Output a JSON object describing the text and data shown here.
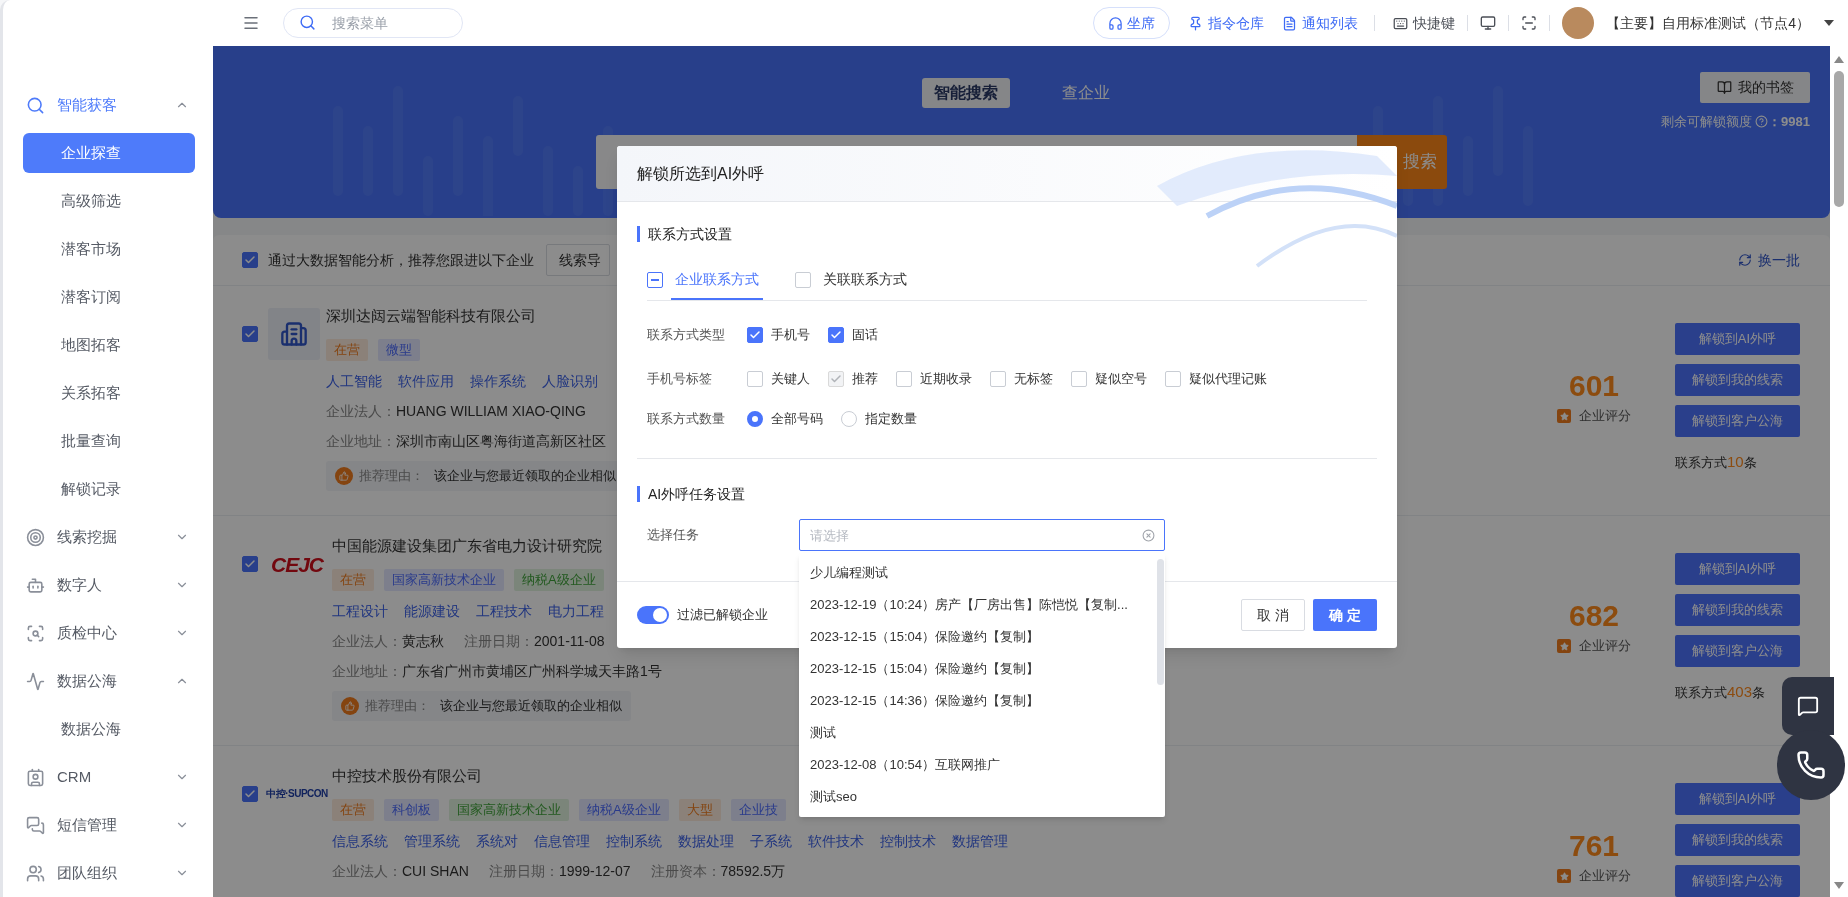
{
  "sidebar": {
    "groups": [
      {
        "label": "智能获客",
        "kind": "search",
        "active": true,
        "expanded": true,
        "children": [
          {
            "label": "企业探查",
            "selected": true
          },
          {
            "label": "高级筛选",
            "selected": false
          },
          {
            "label": "潜客市场",
            "selected": false
          },
          {
            "label": "潜客订阅",
            "selected": false
          },
          {
            "label": "地图拓客",
            "selected": false
          },
          {
            "label": "关系拓客",
            "selected": false
          },
          {
            "label": "批量查询",
            "selected": false
          },
          {
            "label": "解锁记录",
            "selected": false
          }
        ]
      },
      {
        "label": "线索挖掘",
        "kind": "target",
        "active": false,
        "expanded": false
      },
      {
        "label": "数字人",
        "kind": "bot",
        "active": false,
        "expanded": false
      },
      {
        "label": "质检中心",
        "kind": "inspect",
        "active": false,
        "expanded": false
      },
      {
        "label": "数据公海",
        "kind": "data",
        "active": false,
        "expanded": true,
        "children": [
          {
            "label": "数据公海",
            "selected": false
          }
        ]
      },
      {
        "label": "CRM",
        "kind": "crm",
        "active": false,
        "expanded": false
      },
      {
        "label": "短信管理",
        "kind": "sms",
        "active": false,
        "expanded": false
      },
      {
        "label": "团队组织",
        "kind": "team",
        "active": false,
        "expanded": false
      }
    ]
  },
  "header": {
    "menu_search": {
      "placeholder": "搜索菜单"
    },
    "seat_button": "坐席",
    "links": [
      {
        "kind": "commands",
        "label": "指令仓库"
      },
      {
        "kind": "notices",
        "label": "通知列表"
      },
      {
        "kind": "shortcuts",
        "label": "快捷键"
      }
    ],
    "account": "【主要】自用标准测试（节点4）"
  },
  "banner": {
    "tabs": [
      {
        "label": "智能搜索",
        "selected": true
      },
      {
        "label": "查企业",
        "selected": false
      }
    ],
    "search_button": "搜索",
    "bookmark_button": "我的书签",
    "quota_label": "剩余可解锁额度",
    "quota_value": "：9981"
  },
  "list": {
    "select_all": {
      "label": "通过大数据智能分析，推荐您跟进以下企业",
      "checked": true
    },
    "export_button": "线索导",
    "refresh_button": "换一批",
    "companies": [
      {
        "checked": true,
        "logo": {
          "kind": "building"
        },
        "name": "深圳达闼云端智能科技有限公司",
        "tags": [
          {
            "label": "在营",
            "kind": "status"
          },
          {
            "label": "微型",
            "kind": "info"
          }
        ],
        "industries": [
          "人工智能",
          "软件应用",
          "操作系统",
          "人脸识别"
        ],
        "fields": [
          {
            "label": "企业法人：",
            "value": "HUANG WILLIAM XIAO-QING"
          }
        ],
        "address": {
          "label": "企业地址：",
          "value": "深圳市南山区粤海街道高新区社区"
        },
        "reason": {
          "label": "推荐理由：",
          "text": "该企业与您最近领取的企业相似"
        },
        "score": "601",
        "score_label": "企业评分",
        "actions": [
          "解锁到AI外呼",
          "解锁到我的线索",
          "解锁到客户公海"
        ],
        "contacts": {
          "prefix": "联系方式",
          "count": "10",
          "suffix": "条"
        }
      },
      {
        "checked": true,
        "logo": {
          "kind": "wordmark",
          "text": "CEJC"
        },
        "name": "中国能源建设集团广东省电力设计研究院",
        "tags": [
          {
            "label": "在营",
            "kind": "status"
          },
          {
            "label": "国家高新技术企业",
            "kind": "info"
          },
          {
            "label": "纳税A级企业",
            "kind": "success"
          }
        ],
        "industries": [
          "工程设计",
          "能源建设",
          "工程技术",
          "电力工程"
        ],
        "fields": [
          {
            "label": "企业法人：",
            "value": "黄志秋"
          },
          {
            "label": "注册日期：",
            "value": "2001-11-08"
          }
        ],
        "address": {
          "label": "企业地址：",
          "value": "广东省广州市黄埔区广州科学城天丰路1号"
        },
        "reason": {
          "label": "推荐理由：",
          "text": "该企业与您最近领取的企业相似"
        },
        "score": "682",
        "score_label": "企业评分",
        "actions": [
          "解锁到AI外呼",
          "解锁到我的线索",
          "解锁到客户公海"
        ],
        "contacts": {
          "prefix": "联系方式",
          "count": "403",
          "suffix": "条"
        }
      },
      {
        "checked": true,
        "logo": {
          "kind": "logotype",
          "text": "中控·SUPCON"
        },
        "name": "中控技术股份有限公司",
        "tags": [
          {
            "label": "在营",
            "kind": "status"
          },
          {
            "label": "科创板",
            "kind": "info"
          },
          {
            "label": "国家高新技术企业",
            "kind": "success"
          },
          {
            "label": "纳税A级企业",
            "kind": "info"
          },
          {
            "label": "大型",
            "kind": "status"
          },
          {
            "label": "企业技",
            "kind": "info"
          }
        ],
        "industries": [
          "信息系统",
          "管理系统",
          "系统对",
          "信息管理",
          "控制系统",
          "数据处理",
          "子系统",
          "软件技术",
          "控制技术",
          "数据管理"
        ],
        "fields": [
          {
            "label": "企业法人：",
            "value": "CUI SHAN"
          },
          {
            "label": "注册日期：",
            "value": "1999-12-07"
          },
          {
            "label": "注册资本：",
            "value": "78592.5万"
          }
        ],
        "score": "761",
        "score_label": "企业评分",
        "actions": [
          "解锁到AI外呼",
          "解锁到我的线索",
          "解锁到客户公海"
        ]
      }
    ]
  },
  "dialog": {
    "title": "解锁所选到AI外呼",
    "contact_settings": {
      "heading": "联系方式设置",
      "tabs": [
        {
          "label": "企业联系方式",
          "selected": true,
          "indeterminate": true
        },
        {
          "label": "关联联系方式",
          "selected": false,
          "indeterminate": false
        }
      ],
      "rows": [
        {
          "label": "联系方式类型",
          "kind": "checkbox",
          "options": [
            {
              "label": "手机号",
              "checked": true,
              "disabled": false
            },
            {
              "label": "固话",
              "checked": true,
              "disabled": false
            }
          ]
        },
        {
          "label": "手机号标签",
          "kind": "checkbox",
          "options": [
            {
              "label": "关键人",
              "checked": false,
              "disabled": false
            },
            {
              "label": "推荐",
              "checked": true,
              "disabled": true
            },
            {
              "label": "近期收录",
              "checked": false,
              "disabled": false
            },
            {
              "label": "无标签",
              "checked": false,
              "disabled": false
            },
            {
              "label": "疑似空号",
              "checked": false,
              "disabled": false
            },
            {
              "label": "疑似代理记账",
              "checked": false,
              "disabled": false
            }
          ]
        },
        {
          "label": "联系方式数量",
          "kind": "radio",
          "options": [
            {
              "label": "全部号码",
              "selected": true
            },
            {
              "label": "指定数量",
              "selected": false
            }
          ]
        }
      ]
    },
    "task_settings": {
      "heading": "AI外呼任务设置",
      "label": "选择任务",
      "select": {
        "placeholder": "请选择",
        "open": true,
        "options": [
          {
            "label": "少儿编程测试",
            "selected": false
          },
          {
            "label": "2023-12-19（10:24）房产【厂房出售】陈恺悦【复制...",
            "selected": false
          },
          {
            "label": "2023-12-15（15:04）保险邀约【复制】",
            "selected": false
          },
          {
            "label": "2023-12-15（15:04）保险邀约【复制】",
            "selected": false
          },
          {
            "label": "2023-12-15（14:36）保险邀约【复制】",
            "selected": false
          },
          {
            "label": "测试",
            "selected": false
          },
          {
            "label": "2023-12-08（10:54）互联网推广",
            "selected": false
          },
          {
            "label": "测试seo",
            "selected": false
          }
        ]
      }
    },
    "footer": {
      "filter": {
        "label": "过滤已解锁企业",
        "on": true
      },
      "cancel_button": "取 消",
      "confirm_button": "确 定"
    }
  }
}
